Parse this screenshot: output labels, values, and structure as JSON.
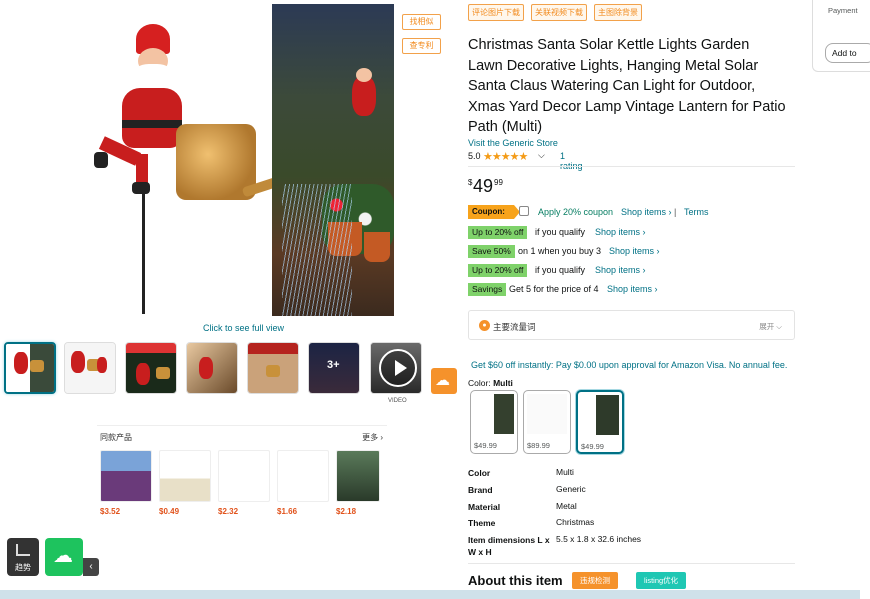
{
  "image_tools": [
    "找相似",
    "查专利"
  ],
  "gallery": {
    "click_full_view": "Click to see full view",
    "more_badge": "3+",
    "video_label": "VIDEO"
  },
  "similar": {
    "title": "同款产品",
    "more": "更多",
    "prices": [
      "$3.52",
      "$0.49",
      "$2.32",
      "$1.66",
      "$2.18"
    ]
  },
  "tools": {
    "trend_label": "趋势"
  },
  "top_tags": [
    "评论图片下载",
    "关联视频下载",
    "主图除背景"
  ],
  "product": {
    "title": "Christmas Santa Solar Kettle Lights Garden Lawn Decorative Lights, Hanging Metal Solar Santa Claus Watering Can Light for Outdoor, Xmas Yard Decor Lamp Vintage Lantern for Patio Path (Multi)",
    "store": "Visit the Generic Store",
    "rating": "5.0",
    "stars": "★★★★★",
    "rating_count": "1 rating",
    "price_symbol": "$",
    "price_whole": "49",
    "price_fraction": "99"
  },
  "coupon": {
    "badge": "Coupon:",
    "text": "Apply 20% coupon",
    "shop": "Shop items ›",
    "separator": "|",
    "terms": "Terms"
  },
  "promos": [
    {
      "badge": "Up to 20% off",
      "text": "if you qualify",
      "link": "Shop items ›"
    },
    {
      "badge": "Save 50%",
      "text": "on 1 when you buy 3",
      "link": "Shop items ›"
    },
    {
      "badge": "Up to 20% off",
      "text": "if you qualify",
      "link": "Shop items ›"
    },
    {
      "badge": "Savings",
      "text": "Get 5 for the price of 4",
      "link": "Shop items ›"
    }
  ],
  "flow_box": {
    "text": "主要流量词",
    "expand": "展开 ⌵"
  },
  "visa_offer": "Get $60 off instantly: Pay $0.00 upon approval for Amazon Visa. No annual fee.",
  "color": {
    "label": "Color:",
    "value": "Multi"
  },
  "swatches": [
    {
      "price": "$49.99",
      "selected": false
    },
    {
      "price": "$89.99",
      "selected": false
    },
    {
      "price": "$49.99",
      "selected": true
    }
  ],
  "specs": [
    {
      "key": "Color",
      "value": "Multi"
    },
    {
      "key": "Brand",
      "value": "Generic"
    },
    {
      "key": "Material",
      "value": "Metal"
    },
    {
      "key": "Theme",
      "value": "Christmas"
    },
    {
      "key": "Item dimensions L x W x H",
      "value": "5.5 x 1.8 x 32.6 inches"
    }
  ],
  "about": {
    "title": "About this item",
    "btn_orange": "违规检测",
    "btn_teal": "listing优化"
  },
  "buybox": {
    "payment": "Payment",
    "add": "Add to"
  },
  "colors": {
    "link": "#007185",
    "orange": "#f5922b",
    "green_badge": "#7fd26a",
    "coupon": "#f7a31b",
    "teal": "#1fc7b3",
    "upload_green": "#1ec35e"
  }
}
